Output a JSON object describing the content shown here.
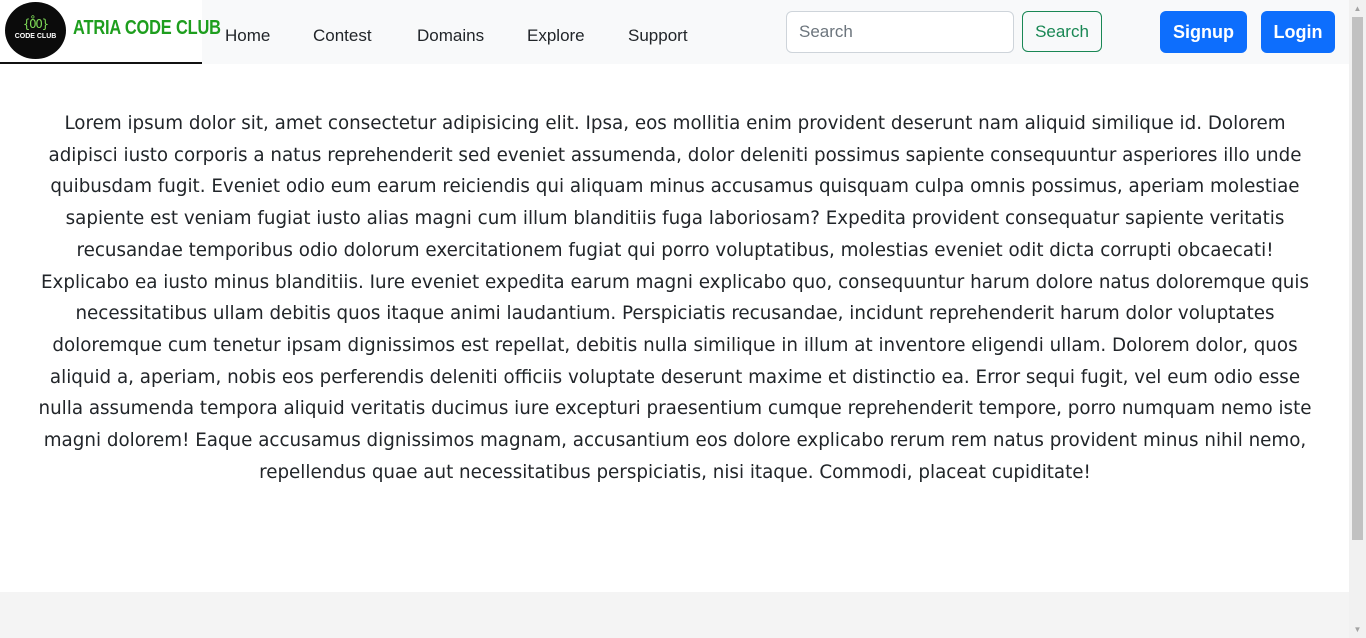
{
  "brand": {
    "logo_top": "{O̊O}",
    "logo_bottom": "CODE CLUB",
    "name": "ATRIA CODE CLUB"
  },
  "nav": {
    "items": [
      {
        "label": "Home"
      },
      {
        "label": "Contest"
      },
      {
        "label": "Domains"
      },
      {
        "label": "Explore"
      },
      {
        "label": "Support"
      }
    ]
  },
  "search": {
    "placeholder": "Search",
    "button_label": "Search"
  },
  "auth": {
    "signup_label": "Signup",
    "login_label": "Login"
  },
  "main": {
    "paragraph": "Lorem ipsum dolor sit, amet consectetur adipisicing elit. Ipsa, eos mollitia enim provident deserunt nam aliquid similique id. Dolorem adipisci iusto corporis a natus reprehenderit sed eveniet assumenda, dolor deleniti possimus sapiente consequuntur asperiores illo unde quibusdam fugit. Eveniet odio eum earum reiciendis qui aliquam minus accusamus quisquam culpa omnis possimus, aperiam molestiae sapiente est veniam fugiat iusto alias magni cum illum blanditiis fuga laboriosam? Expedita provident consequatur sapiente veritatis recusandae temporibus odio dolorum exercitationem fugiat qui porro voluptatibus, molestias eveniet odit dicta corrupti obcaecati! Explicabo ea iusto minus blanditiis. Iure eveniet expedita earum magni explicabo quo, consequuntur harum dolore natus doloremque quis necessitatibus ullam debitis quos itaque animi laudantium. Perspiciatis recusandae, incidunt reprehenderit harum dolor voluptates doloremque cum tenetur ipsam dignissimos est repellat, debitis nulla similique in illum at inventore eligendi ullam. Dolorem dolor, quos aliquid a, aperiam, nobis eos perferendis deleniti officiis voluptate deserunt maxime et distinctio ea. Error sequi fugit, vel eum odio esse nulla assumenda tempora aliquid veritatis ducimus iure excepturi praesentium cumque reprehenderit tempore, porro numquam nemo iste magni dolorem! Eaque accusamus dignissimos magnam, accusantium eos dolore explicabo rerum rem natus provident minus nihil nemo, repellendus quae aut necessitatibus perspiciatis, nisi itaque. Commodi, placeat cupiditate!"
  },
  "colors": {
    "brand_green": "#1e9e1e",
    "primary_blue": "#0d6efd",
    "search_green": "#198754",
    "navbar_bg": "#f8f9fa"
  }
}
